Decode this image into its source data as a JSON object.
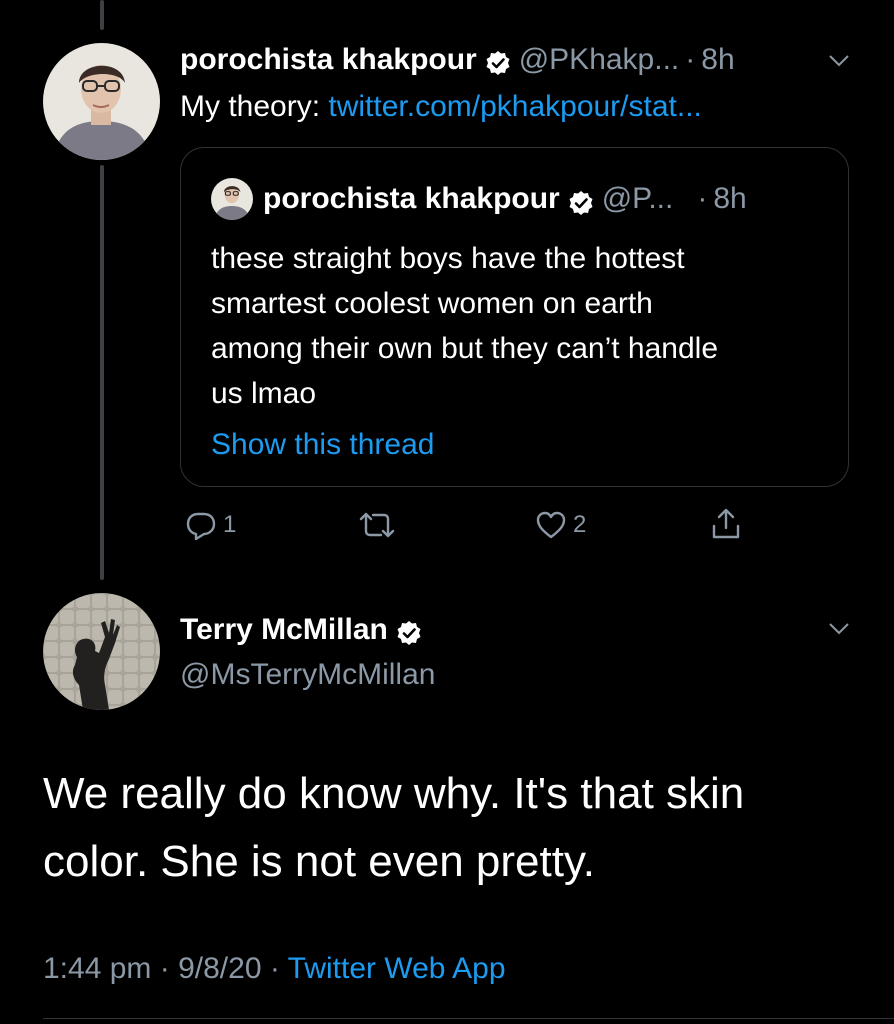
{
  "reply_tweet": {
    "name": "porochista khakpour",
    "handle": "@PKhakp...",
    "separator": "·",
    "time": "8h",
    "text_prefix": "My theory: ",
    "text_link": "twitter.com/pkhakpour/stat...",
    "actions": {
      "reply_count": "1",
      "retweet_count": "",
      "like_count": "2"
    },
    "quoted": {
      "name": "porochista khakpour",
      "handle": "@P...",
      "separator": "·",
      "time": "8h",
      "lines": [
        "these straight boys have the hottest",
        "smartest coolest women on earth",
        "among their own but they can’t handle",
        "us lmao"
      ],
      "show_thread": "Show this thread"
    }
  },
  "main_tweet": {
    "name": "Terry McMillan",
    "handle": "@MsTerryMcMillan",
    "text_line1": "We really do know why. It's that skin",
    "text_line2": "color. She is not even pretty.",
    "time": "1:44 pm",
    "separator": "·",
    "date": "9/8/20",
    "separator2": "·",
    "source": "Twitter Web App"
  },
  "icons": {
    "verified": "verified-badge-icon",
    "more": "chevron-down-icon",
    "reply": "reply-icon",
    "retweet": "retweet-icon",
    "like": "heart-icon",
    "share": "share-icon"
  },
  "colors": {
    "background": "#000000",
    "text": "#ffffff",
    "muted": "#8b98a5",
    "link": "#1d9bf0",
    "border": "#2f3336"
  }
}
